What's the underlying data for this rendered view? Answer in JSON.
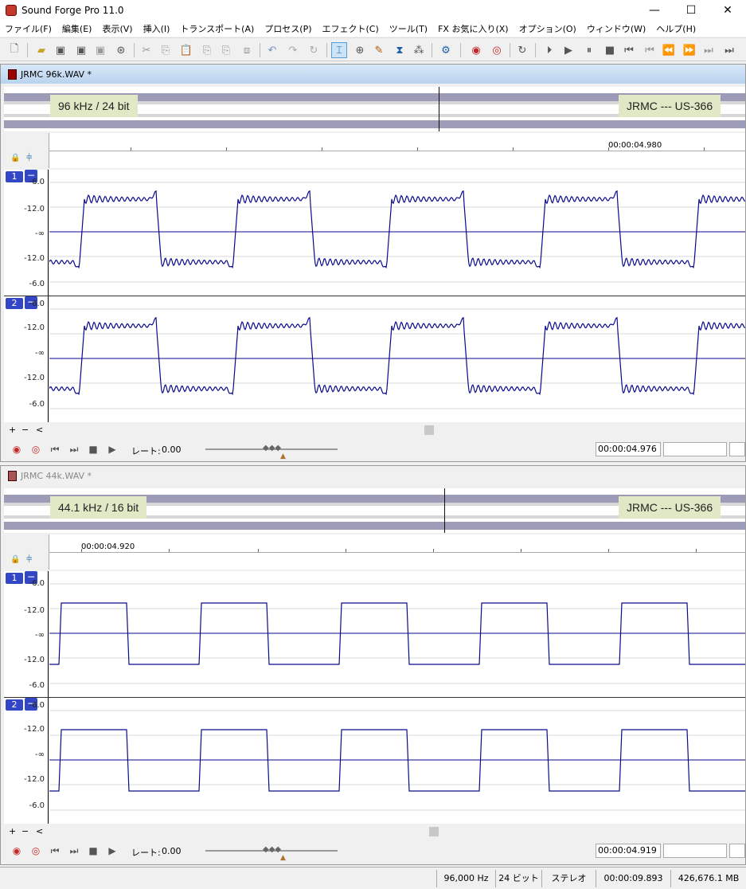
{
  "app": {
    "title": "Sound Forge Pro 11.0",
    "minimize": "—",
    "maximize": "☐",
    "close": "✕"
  },
  "menu": [
    "ファイル(F)",
    "編集(E)",
    "表示(V)",
    "挿入(I)",
    "トランスポート(A)",
    "プロセス(P)",
    "エフェクト(C)",
    "ツール(T)",
    "FX お気に入り(X)",
    "オプション(O)",
    "ウィンドウ(W)",
    "ヘルプ(H)"
  ],
  "colors": {
    "waveform": "#0a0a8c",
    "channel_badge": "#3346c6",
    "label_bg": "#e0e8c6",
    "overview_band": "#9c9cb8"
  },
  "windows": [
    {
      "title": "JRMC 96k.WAV *",
      "state": "active",
      "left_label": "96 kHz / 24 bit",
      "right_label": "JRMC --- US-366",
      "ruler_time": "00:00:04.980",
      "rate_label": "レート:",
      "rate_value": "0.00",
      "cursor_time": "00:00:04.976",
      "channels": [
        {
          "num": "1",
          "db_labels": [
            "-6.0",
            "-12.0",
            "-∞",
            "-12.0",
            "-6.0"
          ]
        },
        {
          "num": "2",
          "db_labels": [
            "-6.0",
            "-12.0",
            "-∞",
            "-12.0",
            "-6.0"
          ]
        }
      ],
      "waveform": {
        "type": "square_with_ringing",
        "cycles_visible": 4.6
      }
    },
    {
      "title": "JRMC 44k.WAV *",
      "state": "inactive",
      "left_label": "44.1 kHz / 16 bit",
      "right_label": "JRMC --- US-366",
      "ruler_time": "00:00:04.920",
      "rate_label": "レート:",
      "rate_value": "0.00",
      "cursor_time": "00:00:04.919",
      "channels": [
        {
          "num": "1",
          "db_labels": [
            "-6.0",
            "-12.0",
            "-∞",
            "-12.0",
            "-6.0"
          ]
        },
        {
          "num": "2",
          "db_labels": [
            "-6.0",
            "-12.0",
            "-∞",
            "-12.0",
            "-6.0"
          ]
        }
      ],
      "waveform": {
        "type": "square_clean",
        "cycles_visible": 4.8
      }
    }
  ],
  "scroll": {
    "plus": "+",
    "minus": "−",
    "left": "<"
  },
  "status": {
    "sample_rate": "96,000 Hz",
    "bit_depth": "24 ビット",
    "channels": "ステレオ",
    "length": "00:00:09.893",
    "free_space": "426,676.1 MB"
  }
}
